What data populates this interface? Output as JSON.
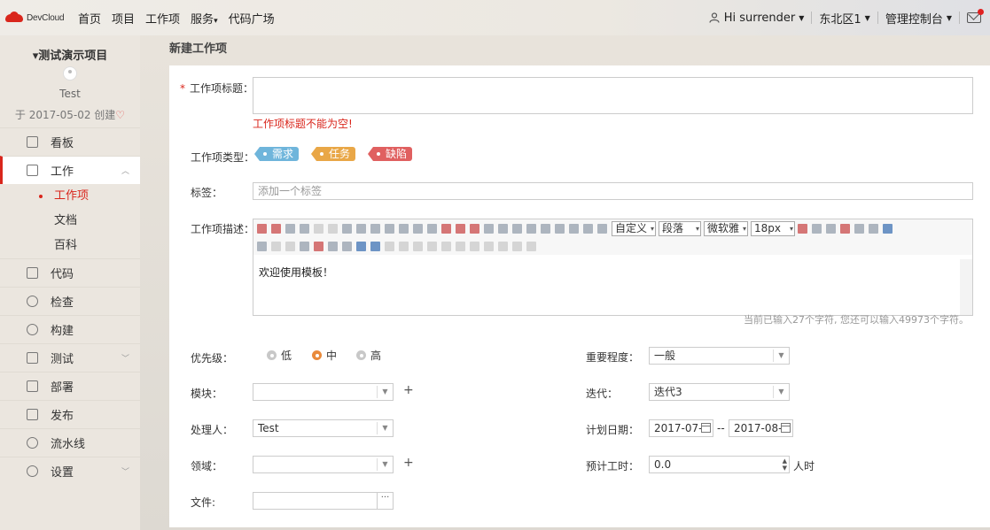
{
  "topbar": {
    "logo_text": "DevCloud",
    "nav": [
      {
        "label": "首页"
      },
      {
        "label": "项目"
      },
      {
        "label": "工作项"
      },
      {
        "label": "服务"
      },
      {
        "label": "代码广场"
      }
    ],
    "user": "Hi surrender",
    "region": "东北区1",
    "console": "管理控制台"
  },
  "sidebar": {
    "project_title": "▾测试演示项目",
    "project_name": "Test",
    "created": "于 2017-05-02 创建",
    "menu": [
      {
        "label": "看板",
        "icon": "layers-icon"
      },
      {
        "label": "工作",
        "icon": "document-icon"
      },
      {
        "label": "代码",
        "icon": "code-icon"
      },
      {
        "label": "检查",
        "icon": "globe-icon"
      },
      {
        "label": "构建",
        "icon": "gear-icon"
      },
      {
        "label": "测试",
        "icon": "test-icon"
      },
      {
        "label": "部署",
        "icon": "cube-icon"
      },
      {
        "label": "发布",
        "icon": "package-icon"
      },
      {
        "label": "流水线",
        "icon": "pipeline-icon"
      },
      {
        "label": "设置",
        "icon": "settings-icon"
      }
    ],
    "sub": [
      {
        "label": "工作项"
      },
      {
        "label": "文档"
      },
      {
        "label": "百科"
      }
    ]
  },
  "main": {
    "title": "新建工作项",
    "fields": {
      "title_label": "工作项标题：",
      "title_value": "",
      "title_error": "工作项标题不能为空!",
      "type_label": "工作项类型：",
      "types": [
        "需求",
        "任务",
        "缺陷"
      ],
      "tags_label": "标签：",
      "tags_placeholder": "添加一个标签",
      "desc_label": "工作项描述：",
      "desc_text": "欢迎使用模板！",
      "toolbar_selects": [
        "自定义",
        "段落",
        "微软雅",
        "18px"
      ],
      "editor_status": "当前已输入27个字符, 您还可以输入49973个字符。",
      "priority_label": "优先级：",
      "priority_options": [
        "低",
        "中",
        "高"
      ],
      "priority_selected": "中",
      "importance_label": "重要程度：",
      "importance_value": "一般",
      "module_label": "模块：",
      "module_value": "",
      "iteration_label": "迭代：",
      "iteration_value": "迭代3",
      "assignee_label": "处理人：",
      "assignee_value": "Test",
      "plan_date_label": "计划日期：",
      "plan_date_start": "2017-07-",
      "plan_date_sep": "--",
      "plan_date_end": "2017-08-",
      "domain_label": "领域：",
      "domain_value": "",
      "estimate_label": "预计工时：",
      "estimate_value": "0.0",
      "estimate_unit": "人时",
      "file_label": "文件:",
      "file_btn": "···"
    }
  }
}
